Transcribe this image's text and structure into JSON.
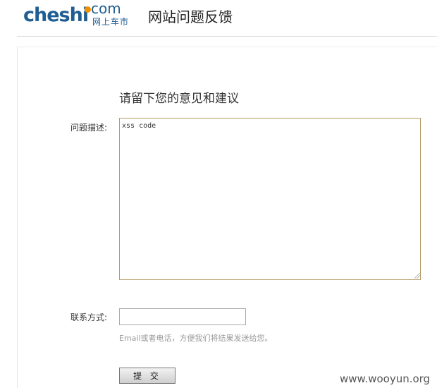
{
  "header": {
    "logo_main": "cheshi",
    "logo_com": "com",
    "logo_sub": "网上车市",
    "title": "网站问题反馈"
  },
  "form": {
    "heading": "请留下您的意见和建议",
    "description_label": "问题描述:",
    "description_value": "xss code",
    "contact_label": "联系方式:",
    "contact_value": "",
    "contact_hint": "Email或者电话，方便我们将结果发送给您。",
    "submit_label": "提 交"
  },
  "watermark": "www.wooyun.org",
  "colors": {
    "brand_blue": "#1f5d92",
    "brand_orange": "#f29000",
    "textarea_border": "#b49a63"
  }
}
